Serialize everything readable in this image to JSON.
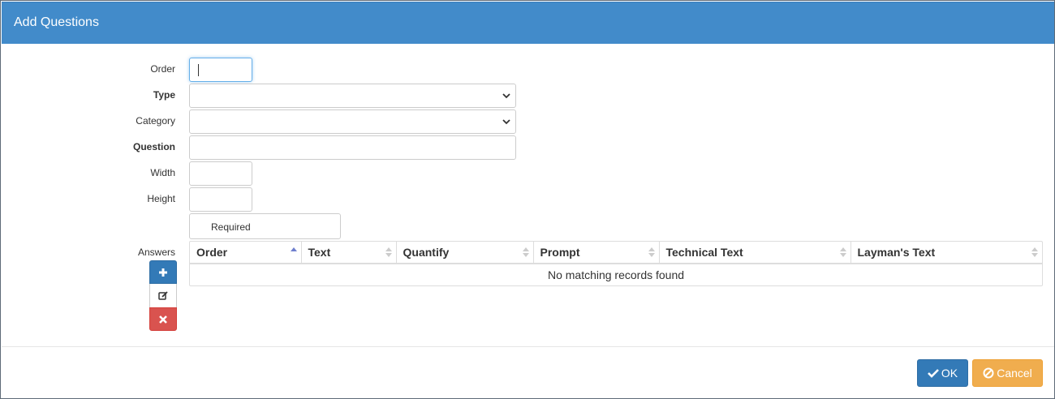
{
  "modal": {
    "title": "Add Questions"
  },
  "form": {
    "order": {
      "label": "Order",
      "value": ""
    },
    "type": {
      "label": "Type",
      "value": ""
    },
    "category": {
      "label": "Category",
      "value": ""
    },
    "question": {
      "label": "Question",
      "value": ""
    },
    "width": {
      "label": "Width",
      "value": ""
    },
    "height": {
      "label": "Height",
      "value": ""
    },
    "required": {
      "label": "Required",
      "checked": false
    }
  },
  "answers": {
    "label": "Answers",
    "buttons": [
      {
        "icon": "plus-icon",
        "glyph": "✚"
      },
      {
        "icon": "edit-icon",
        "glyph": "✎"
      },
      {
        "icon": "delete-icon",
        "glyph": "✖"
      }
    ],
    "columns": [
      "Order",
      "Text",
      "Quantify",
      "Prompt",
      "Technical Text",
      "Layman's Text"
    ],
    "empty_text": "No matching records found"
  },
  "footer": {
    "ok_label": "OK",
    "cancel_label": "Cancel"
  },
  "colors": {
    "header": "#428bca",
    "primary": "#337ab7",
    "danger": "#d9534f",
    "warning": "#f0ad4e"
  }
}
